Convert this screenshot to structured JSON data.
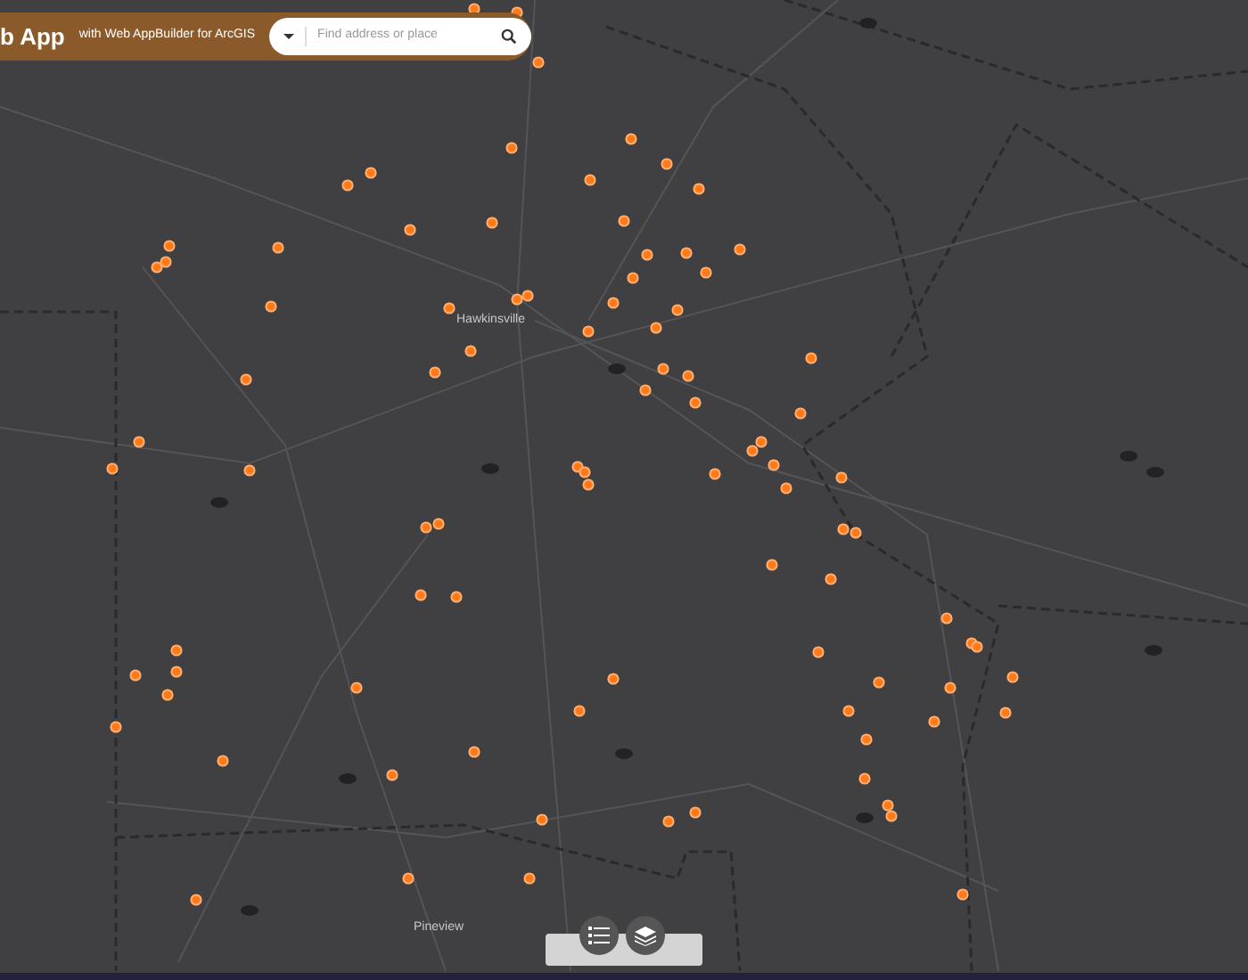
{
  "header": {
    "title": "b App",
    "subtitle": "with Web AppBuilder for ArcGIS"
  },
  "search": {
    "placeholder": "Find address or place"
  },
  "map_labels": [
    {
      "text": "Hawkinsville"
    },
    {
      "text": "Pineview"
    }
  ],
  "widget_bar": {
    "buttons": [
      {
        "kind": "legend"
      },
      {
        "kind": "layers"
      }
    ]
  }
}
